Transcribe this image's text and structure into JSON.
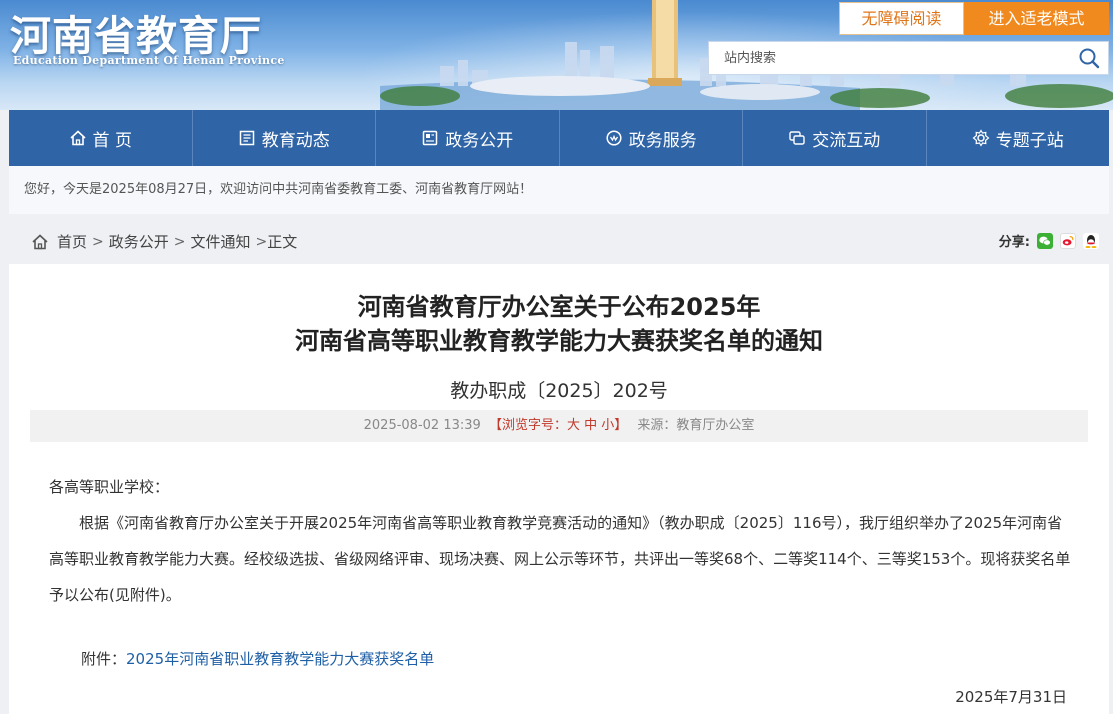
{
  "header": {
    "title": "河南省教育厅",
    "subtitle": "Education Department Of Henan Province",
    "accessibility_button": "无障碍阅读",
    "elder_mode_button": "进入适老模式",
    "search_placeholder": "站内搜索"
  },
  "nav": {
    "items": [
      {
        "label": "首 页",
        "icon": "home-icon"
      },
      {
        "label": "教育动态",
        "icon": "news-icon"
      },
      {
        "label": "政务公开",
        "icon": "document-icon"
      },
      {
        "label": "政务服务",
        "icon": "service-icon"
      },
      {
        "label": "交流互动",
        "icon": "chat-icon"
      },
      {
        "label": "专题子站",
        "icon": "topic-icon"
      }
    ]
  },
  "welcome": "您好，今天是2025年08月27日，欢迎访问中共河南省委教育工委、河南省教育厅网站！",
  "breadcrumb": {
    "items": [
      "首页",
      "政务公开",
      "文件通知"
    ],
    "current": "正文",
    "separator": ">"
  },
  "share": {
    "label": "分享:",
    "icons": [
      "wechat-icon",
      "weibo-icon",
      "qq-icon"
    ]
  },
  "article": {
    "title_line1": "河南省教育厅办公室关于公布2025年",
    "title_line2": "河南省高等职业教育教学能力大赛获奖名单的通知",
    "doc_number": "教办职成〔2025〕202号",
    "datetime": "2025-08-02 13:39",
    "font_size_label": "【浏览字号：大 中 小】",
    "source": "来源：教育厅办公室",
    "salutation": "各高等职业学校：",
    "paragraph": "根据《河南省教育厅办公室关于开展2025年河南省高等职业教育教学竞赛活动的通知》（教办职成〔2025〕116号），我厅组织举办了2025年河南省高等职业教育教学能力大赛。经校级选拔、省级网络评审、现场决赛、网上公示等环节，共评出一等奖68个、二等奖114个、三等奖153个。现将获奖名单予以公布(见附件)。",
    "attachment_label": "附件：",
    "attachment_link": "2025年河南省职业教育教学能力大赛获奖名单",
    "sign_date": "2025年7月31日"
  },
  "colors": {
    "nav_bg": "#2f64a6",
    "accent_orange": "#f08a1e",
    "font_size_red": "#c0392b",
    "link_blue": "#1f5fa6"
  }
}
